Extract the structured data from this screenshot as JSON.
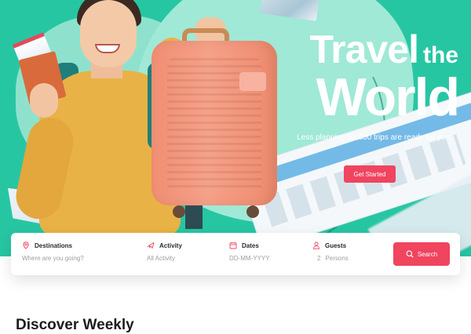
{
  "hero": {
    "title_line1": "Travel",
    "title_line1b": "the",
    "title_line2": "World",
    "subtitle": "Less planning 50,000 trips are ready for you.",
    "cta_label": "Get Started"
  },
  "search": {
    "fields": [
      {
        "label": "Destinations",
        "value": "Where are you going?",
        "icon": "location-pin-icon"
      },
      {
        "label": "Activity",
        "value": "All Activity",
        "icon": "plane-icon"
      },
      {
        "label": "Dates",
        "value": "DD-MM-YYYY",
        "icon": "calendar-icon"
      },
      {
        "label": "Guests",
        "count": "2",
        "unit": "Persons",
        "icon": "person-icon"
      }
    ],
    "button_label": "Search"
  },
  "section": {
    "title": "Discover Weekly"
  },
  "colors": {
    "accent": "#f0445f",
    "hero_bg": "#27c6a3",
    "hero_light": "#9fe9d6"
  }
}
